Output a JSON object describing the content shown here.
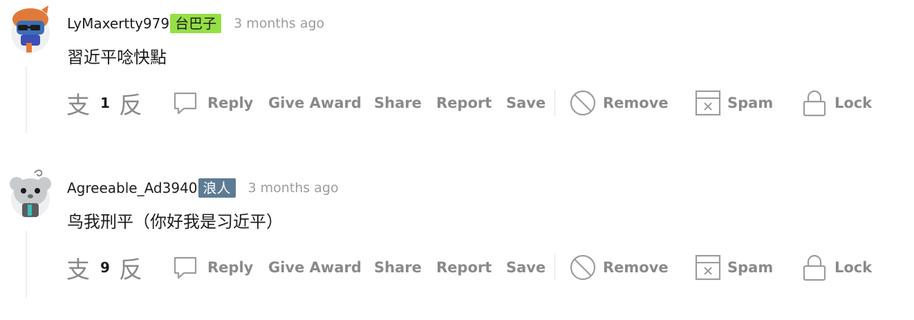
{
  "comments": [
    {
      "username": "LyMaxertty979",
      "flair": "台巴子",
      "flair_color": "#94e044",
      "time": "3 months ago",
      "body": "習近平唸快點",
      "vote_count": "1",
      "upvote_glyph": "支",
      "downvote_glyph": "反"
    },
    {
      "username": "Agreeable_Ad3940",
      "flair": "浪人",
      "flair_color": "#5d7b94",
      "time": "3 months ago",
      "body": "鸟我刑平（你好我是习近平）",
      "vote_count": "9",
      "upvote_glyph": "支",
      "downvote_glyph": "反"
    }
  ],
  "actions": {
    "reply": "Reply",
    "give_award": "Give Award",
    "share": "Share",
    "report": "Report",
    "save": "Save",
    "remove": "Remove",
    "spam": "Spam",
    "lock": "Lock"
  },
  "icons": {
    "reply": "speech-bubble-icon",
    "remove": "circle-slash-icon",
    "spam": "spam-box-icon",
    "lock": "lock-icon"
  }
}
